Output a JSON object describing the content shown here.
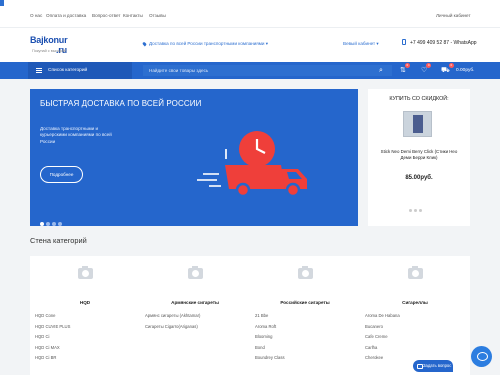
{
  "topbar": {
    "links": [
      "О нас",
      "Оплата и доставка",
      "Вопрос-ответ",
      "Контакты",
      "Отзывы"
    ],
    "account": "Личный кабинет"
  },
  "header": {
    "logo_main": "Bajkonur",
    "logo_ru": ".ru",
    "tagline": "Покупай с выгодой!",
    "delivery_link": "Доставка по всей России транспортными компаниями",
    "favorites_link": "Вевый кабинет",
    "phone": "+7 499 409 52 87 - WhatsApp"
  },
  "nav": {
    "catalog_button": "Список категорий",
    "search_placeholder": "Найдите свои товары здесь",
    "compare_count": "0",
    "wishlist_count": "0",
    "cart_count": "0",
    "cart_total": "0.00руб."
  },
  "banner": {
    "title": "БЫСТРАЯ ДОСТАВКА ПО ВСЕЙ РОССИИ",
    "description": "Доставка транспортными и курьерскими компаниями по всей России",
    "button": "Подробнее"
  },
  "promo": {
    "title": "КУПИТЬ СО СКИДКОЙ:",
    "product_name": "Stick Neo Demi Berry Click (Стики Нео Деми Берри Клик)",
    "price": "85.00руб."
  },
  "category_wall": {
    "title": "Стена категорий",
    "columns": [
      {
        "title": "HQD",
        "items": [
          "HQD Cone",
          "HQD CUVIE PLUS",
          "HQD Ci",
          "HQD Ci MAX",
          "HQD Ci BR"
        ]
      },
      {
        "title": "Армянские сигареты",
        "items": [
          "Армянс сигареты (Akhtamar)",
          "Сигареты Cigarro(Ariganas)"
        ]
      },
      {
        "title": "Российские сигареты",
        "items": [
          "21 Bbe",
          "Aroma Roft",
          "Blooming",
          "Bond",
          "Boundrey Class"
        ]
      },
      {
        "title": "Сигареллы",
        "items": [
          "Aroma De Habana",
          "Bucanero",
          "Cafe Creme",
          "Carlha",
          "Cherokee"
        ]
      }
    ]
  },
  "chat": {
    "ask_button": "Задать вопрос"
  }
}
